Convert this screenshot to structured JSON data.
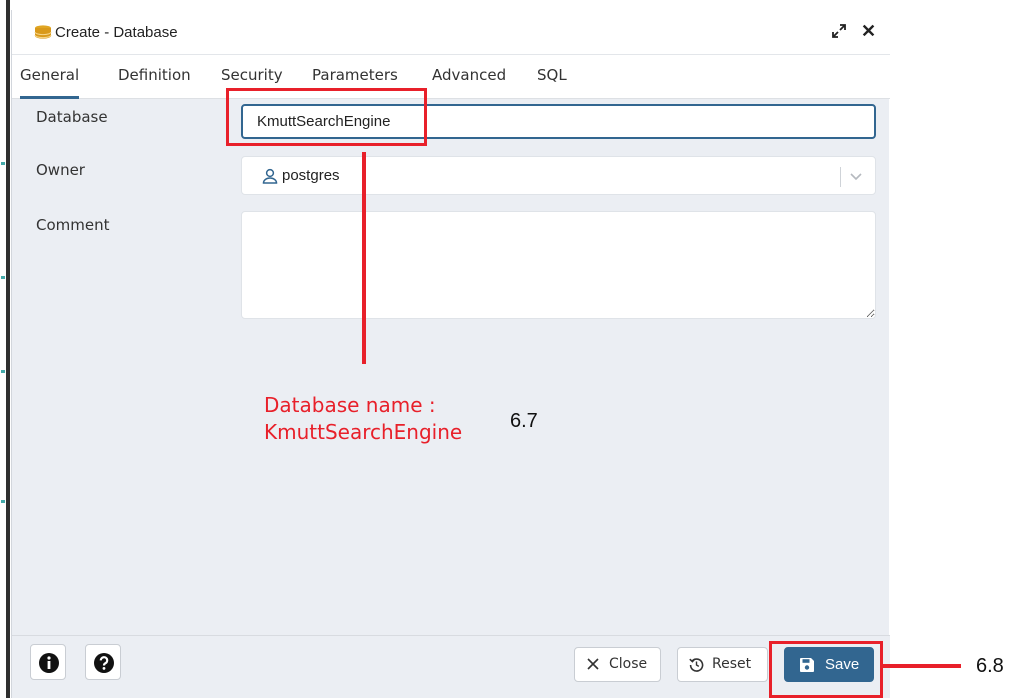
{
  "window": {
    "title": "Create - Database",
    "icon": "database-icon"
  },
  "tabs": [
    {
      "label": "General",
      "active": true
    },
    {
      "label": "Definition",
      "active": false
    },
    {
      "label": "Security",
      "active": false
    },
    {
      "label": "Parameters",
      "active": false
    },
    {
      "label": "Advanced",
      "active": false
    },
    {
      "label": "SQL",
      "active": false
    }
  ],
  "form": {
    "database": {
      "label": "Database",
      "value": "KmuttSearchEngine"
    },
    "owner": {
      "label": "Owner",
      "value": "postgres",
      "icon": "user-icon"
    },
    "comment": {
      "label": "Comment",
      "value": ""
    }
  },
  "footer": {
    "info_icon": "info-icon",
    "help_icon": "help-icon",
    "close_label": "Close",
    "reset_label": "Reset",
    "save_label": "Save"
  },
  "annotations": {
    "note_line1": "Database name :",
    "note_line2": "KmuttSearchEngine",
    "step_67": "6.7",
    "step_68": "6.8"
  },
  "colors": {
    "accent": "#326690",
    "annotation": "#e8202a",
    "panel_bg": "#ebeef3"
  }
}
